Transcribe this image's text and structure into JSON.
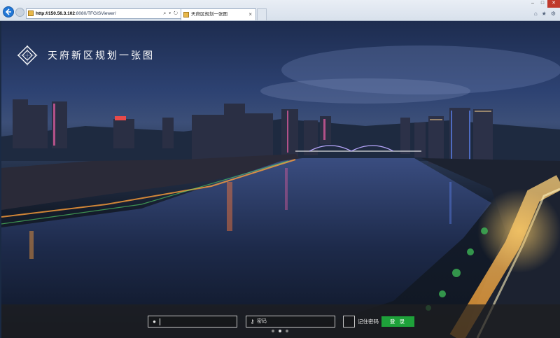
{
  "browser": {
    "url_host": "http://150.56.3.102",
    "url_rest": ":8080/TFGISViewer/",
    "url_tools": "⌕ ▾ ↻",
    "tab_title": "天府区规划一张图",
    "tab_close": "×",
    "window_controls": [
      "–",
      "□",
      "✕"
    ],
    "right_tools": [
      "⌂",
      "★",
      "⚙"
    ]
  },
  "page": {
    "brand_title": "天府新区规划一张图",
    "login": {
      "username_value": "",
      "username_placeholder": "",
      "password_placeholder": "密码",
      "remember_label": "记住密码",
      "login_button": "登 录",
      "user_icon": "user-icon",
      "key_icon": "key-icon"
    },
    "carousel": {
      "count": 3,
      "active": 1
    }
  },
  "colors": {
    "accent_green": "#1ea13a",
    "browser_blue": "#2277d6",
    "login_bar": "#1e1e20"
  }
}
